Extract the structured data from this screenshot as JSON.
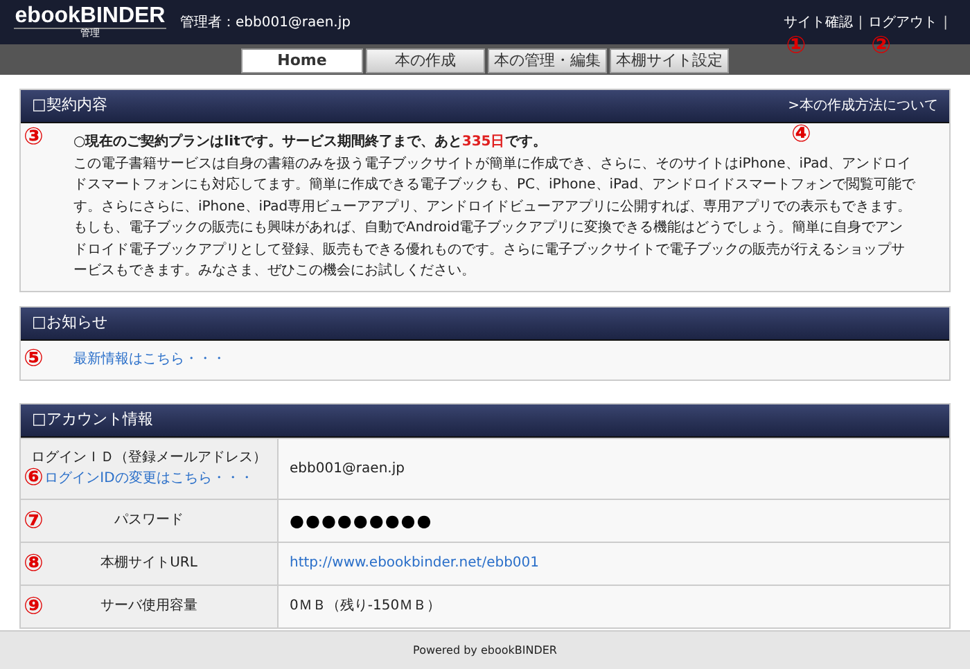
{
  "header": {
    "logo": "ebookBINDER",
    "logo_sub": "管理",
    "admin": "管理者：ebb001@raen.jp",
    "links": [
      {
        "label": "サイト確認",
        "separator": "|",
        "marker": "①"
      },
      {
        "label": "ログアウト",
        "separator": "|",
        "marker": "②"
      }
    ]
  },
  "nav": [
    {
      "label": "Home",
      "selected": true
    },
    {
      "label": "本の作成",
      "selected": false
    },
    {
      "label": "本の管理・編集",
      "selected": false
    },
    {
      "label": "本棚サイト設定",
      "selected": false
    }
  ],
  "contract": {
    "title": "□契約内容",
    "marker": "③",
    "link": ">本の作成方法について",
    "link_marker": "④",
    "headline": "○現在のご契約プランはlitです。サービス期間終了まで、あと",
    "days": "335日",
    "headline_end": "です。",
    "body": "この電子書籍サービスは自身の書籍のみを扱う電子ブックサイトが簡単に作成でき、さらに、そのサイトはiPhone、iPad、アンドロイドスマートフォンにも対応してます。簡単に作成できる電子ブックも、PC、iPhone、iPad、アンドロイドスマートフォンで閲覧可能です。さらにさらに、iPhone、iPad専用ビューアアプリ、アンドロイドビューアアプリに公開すれば、専用アプリでの表示もできます。もしも、電子ブックの販売にも興味があれば、自動でAndroid電子ブックアプリに変換できる機能はどうでしょう。簡単に自身でアンドロイド電子ブックアプリとして登録、販売もできる優れものです。さらに電子ブックサイトで電子ブックの販売が行えるショップサービスもできます。みなさま、ぜひこの機会にお試しください。"
  },
  "news": {
    "title": "□お知らせ",
    "marker": "⑤",
    "link": "最新情報はこちら・・・"
  },
  "account": {
    "title": "□アカウント情報",
    "rows": [
      {
        "kind": "text",
        "label": "ログインＩＤ（登録メールアドレス）",
        "sublink": "ログインIDの変更はこちら・・・",
        "marker": "⑥",
        "value": "ebb001@raen.jp"
      },
      {
        "kind": "password",
        "label": "パスワード",
        "marker": "⑦",
        "value": "●●●●●●●●●"
      },
      {
        "kind": "link",
        "label": "本棚サイトURL",
        "marker": "⑧",
        "value": "http://www.ebookbinder.net/ebb001"
      },
      {
        "kind": "text",
        "label": "サーバ使用容量",
        "marker": "⑨",
        "value": "0ＭＢ（残り-150ＭＢ）"
      }
    ]
  },
  "footer": "Powered by ebookBINDER"
}
